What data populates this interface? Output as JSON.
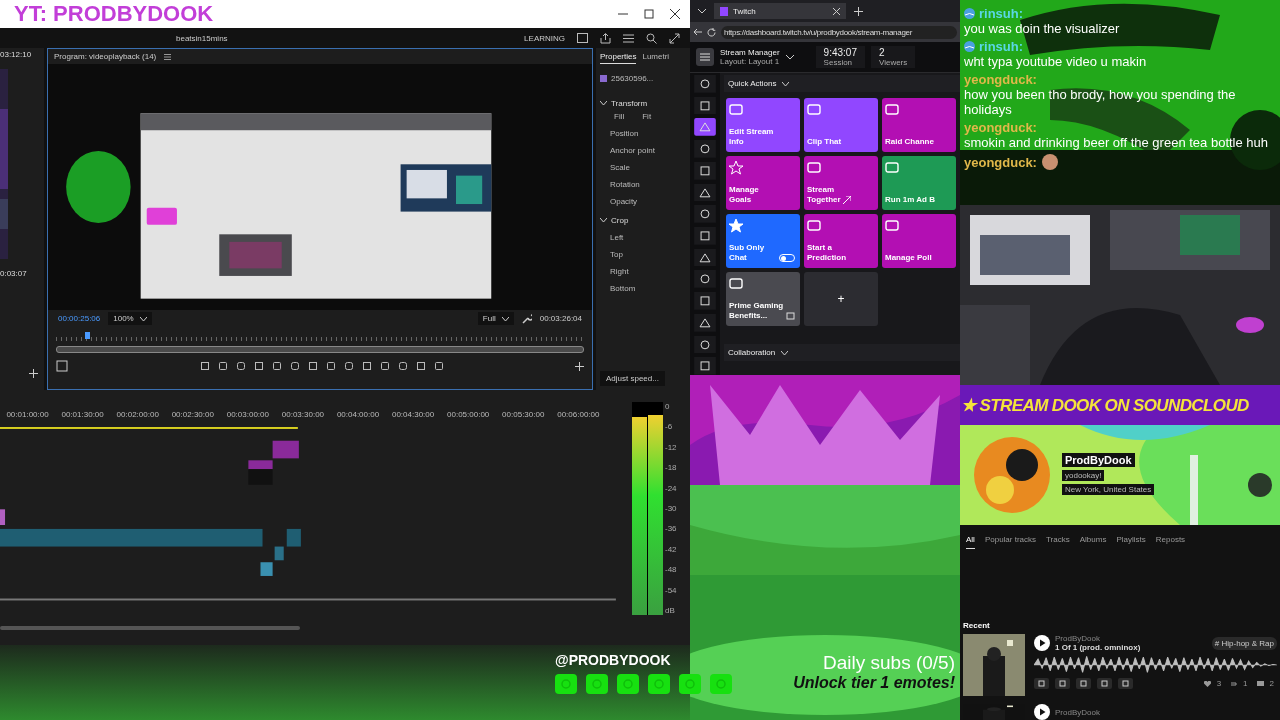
{
  "overlay_title": "YT: PRODBYDOOK",
  "premiere": {
    "project": "beatsin15mins",
    "workspace": "LEARNING",
    "source": {
      "timecode_top": "03:12:10",
      "timecode_bottom": "0:03:07"
    },
    "program": {
      "title": "Program: videoplayback (14)",
      "timecode": "00:00:25:06",
      "zoom": "100%",
      "quality": "Full",
      "duration": "00:03:26:04",
      "level": 0.055
    },
    "properties": {
      "tabs": [
        {
          "label": "Properties",
          "selected": true
        },
        {
          "label": "Lumetri",
          "selected": false
        }
      ],
      "clip": "25630596...",
      "fill": "Fill",
      "fit": "Fit",
      "sections": [
        {
          "label": "Transform",
          "expanded": true,
          "items": [
            "Position",
            "Anchor point",
            "Scale",
            "Rotation",
            "Opacity"
          ]
        },
        {
          "label": "Crop",
          "expanded": true,
          "items": [
            "Left",
            "Top",
            "Right",
            "Bottom"
          ]
        }
      ],
      "adjust": "Adjust speed..."
    },
    "timeline": {
      "ruler": [
        "00:01:00:00",
        "00:01:30:00",
        "00:02:00:00",
        "00:02:30:00",
        "00:03:00:00",
        "00:03:30:00",
        "00:04:00:00",
        "00:04:30:00",
        "00:05:00:00",
        "00:05:30:00",
        "00:06:00:00"
      ],
      "meter_scale": [
        "0",
        "-6",
        "-12",
        "-18",
        "-24",
        "-30",
        "-36",
        "-42",
        "-48",
        "-54",
        "dB"
      ],
      "meters": [
        {
          "level": 0.93
        },
        {
          "level": 0.94
        }
      ]
    }
  },
  "twitch": {
    "tab": "Twitch",
    "url": "https://dashboard.twitch.tv/u/prodbydook/stream-manager",
    "title": "Stream Manager",
    "layout": "Layout: Layout 1",
    "stats": [
      {
        "value": "9:43:07",
        "label": "Session"
      },
      {
        "value": "2",
        "label": "Viewers"
      }
    ],
    "nav": [
      {
        "selected": false
      },
      {
        "selected": false
      },
      {
        "selected": true
      },
      {
        "selected": false
      },
      {
        "selected": false
      },
      {
        "selected": false
      },
      {
        "selected": false
      },
      {
        "selected": false
      },
      {
        "selected": false
      },
      {
        "selected": false
      },
      {
        "selected": false
      },
      {
        "selected": false
      },
      {
        "selected": false
      },
      {
        "selected": false
      }
    ],
    "quick_actions": "Quick Actions",
    "actions": [
      {
        "kind": "action",
        "label": "Edit Stream Info",
        "color": "#9147ff"
      },
      {
        "kind": "action",
        "label": "Clip That",
        "color": "#9147ff"
      },
      {
        "kind": "action",
        "label": "Raid Channe",
        "color": "#b30fb3"
      },
      {
        "kind": "action",
        "label": "Manage Goals",
        "color": "#b30fb3"
      },
      {
        "kind": "external",
        "label": "Stream Together",
        "color": "#b30fb3"
      },
      {
        "kind": "action",
        "label": "Run 1m Ad B",
        "color": "#1e9a55"
      },
      {
        "kind": "toggle",
        "label": "Sub Only Chat",
        "color": "#1f69ff",
        "on": false
      },
      {
        "kind": "action",
        "label": "Start a Prediction",
        "color": "#b30fb3"
      },
      {
        "kind": "action",
        "label": "Manage Poll",
        "color": "#b30fb3"
      },
      {
        "kind": "benefit",
        "label": "Prime Gaming Benefits...",
        "color": "#4a4a50"
      },
      {
        "kind": "add",
        "label": "+",
        "color": "#2c2c31"
      }
    ],
    "collaboration": "Collaboration"
  },
  "chat": [
    {
      "user": "rinsuh:",
      "color": "#5ad7e6",
      "badge": true,
      "kind": "text",
      "text": "you was doin the visualizer"
    },
    {
      "user": "rinsuh:",
      "color": "#5ad7e6",
      "badge": true,
      "kind": "text",
      "text": "wht typa youtube video u makin"
    },
    {
      "user": "yeongduck:",
      "color": "#e0b84a",
      "badge": false,
      "kind": "text",
      "text": "how you been tho brody, how you spending the holidays"
    },
    {
      "user": "yeongduck:",
      "color": "#e0b84a",
      "badge": false,
      "kind": "text",
      "text": "smokin and drinking beer off the green tea bottle huh"
    },
    {
      "user": "yeongduck:",
      "color": "#e0b84a",
      "badge": false,
      "kind": "emote"
    }
  ],
  "soundcloud": {
    "banner": "★ STREAM DOOK ON SOUNDCLOUD",
    "name": "ProdByDook",
    "handle": "yodookay!",
    "location": "New York, United States",
    "tabs": [
      {
        "label": "All",
        "selected": true
      },
      {
        "label": "Popular tracks",
        "selected": false
      },
      {
        "label": "Tracks",
        "selected": false
      },
      {
        "label": "Albums",
        "selected": false
      },
      {
        "label": "Playlists",
        "selected": false
      },
      {
        "label": "Reposts",
        "selected": false
      }
    ],
    "recent": "Recent",
    "tracks": [
      {
        "artist": "ProdByDook",
        "title": "1 Of 1 (prod. omninox)",
        "tag": "# Hip-hop & Rap",
        "likes": "3",
        "reposts": "1",
        "comments": "2"
      },
      {
        "artist": "ProdByDook"
      }
    ]
  },
  "footer": {
    "handle": "@PRODBYDOOK",
    "goal": "Daily subs (0/5)",
    "reward": "Unlock tier 1 emotes!"
  }
}
